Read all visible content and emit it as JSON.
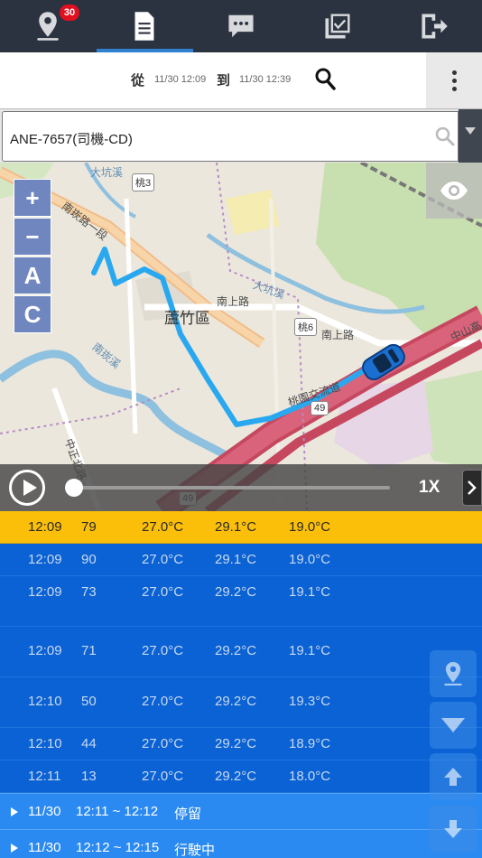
{
  "nav": {
    "badge_count": "30",
    "tabs": [
      "location",
      "report",
      "message",
      "tasks",
      "logout"
    ],
    "active": "report"
  },
  "filter": {
    "from_label": "從",
    "from_time": "11/30 12:09",
    "to_label": "到",
    "to_time": "11/30 12:39"
  },
  "vehicle": {
    "selected": "ANE-7657(司機-CD)"
  },
  "map": {
    "controls": [
      "+",
      "−",
      "A",
      "C"
    ],
    "labels": {
      "district": "蘆竹區",
      "road1": "南上路",
      "road2": "南上路",
      "road3": "南崁路一段",
      "river1": "大坑溪",
      "river2": "大坑溪",
      "river3": "南崁溪",
      "road4": "中正北路",
      "road5": "中山高",
      "road6": "桃園交流道",
      "shield1": "桃3",
      "shield2": "桃6",
      "shield3": "49",
      "shield4": "49"
    }
  },
  "playback": {
    "speed": "1X",
    "progress": 0
  },
  "records": [
    {
      "time": "12:09",
      "speed": "79",
      "t1": "27.0°C",
      "t2": "29.1°C",
      "t3": "19.0°C",
      "active": true
    },
    {
      "time": "12:09",
      "speed": "90",
      "t1": "27.0°C",
      "t2": "29.1°C",
      "t3": "19.0°C"
    },
    {
      "time": "12:09",
      "speed": "73",
      "t1": "27.0°C",
      "t2": "29.2°C",
      "t3": "19.1°C"
    },
    {
      "time": "12:09",
      "speed": "71",
      "t1": "27.0°C",
      "t2": "29.2°C",
      "t3": "19.1°C"
    },
    {
      "time": "12:10",
      "speed": "50",
      "t1": "27.0°C",
      "t2": "29.2°C",
      "t3": "19.3°C"
    },
    {
      "time": "12:10",
      "speed": "44",
      "t1": "27.0°C",
      "t2": "29.2°C",
      "t3": "18.9°C"
    },
    {
      "time": "12:11",
      "speed": "13",
      "t1": "27.0°C",
      "t2": "29.2°C",
      "t3": "18.0°C"
    }
  ],
  "segments": [
    {
      "date": "11/30",
      "range": "12:11 ~ 12:12",
      "status": "停留"
    },
    {
      "date": "11/30",
      "range": "12:12 ~ 12:15",
      "status": "行駛中"
    }
  ],
  "colors": {
    "nav_bg": "#2c3340",
    "accent": "#2f80d1",
    "row_active": "#fbbf0a",
    "list_bg": "#0a62d4",
    "route": "#29a8f0"
  }
}
